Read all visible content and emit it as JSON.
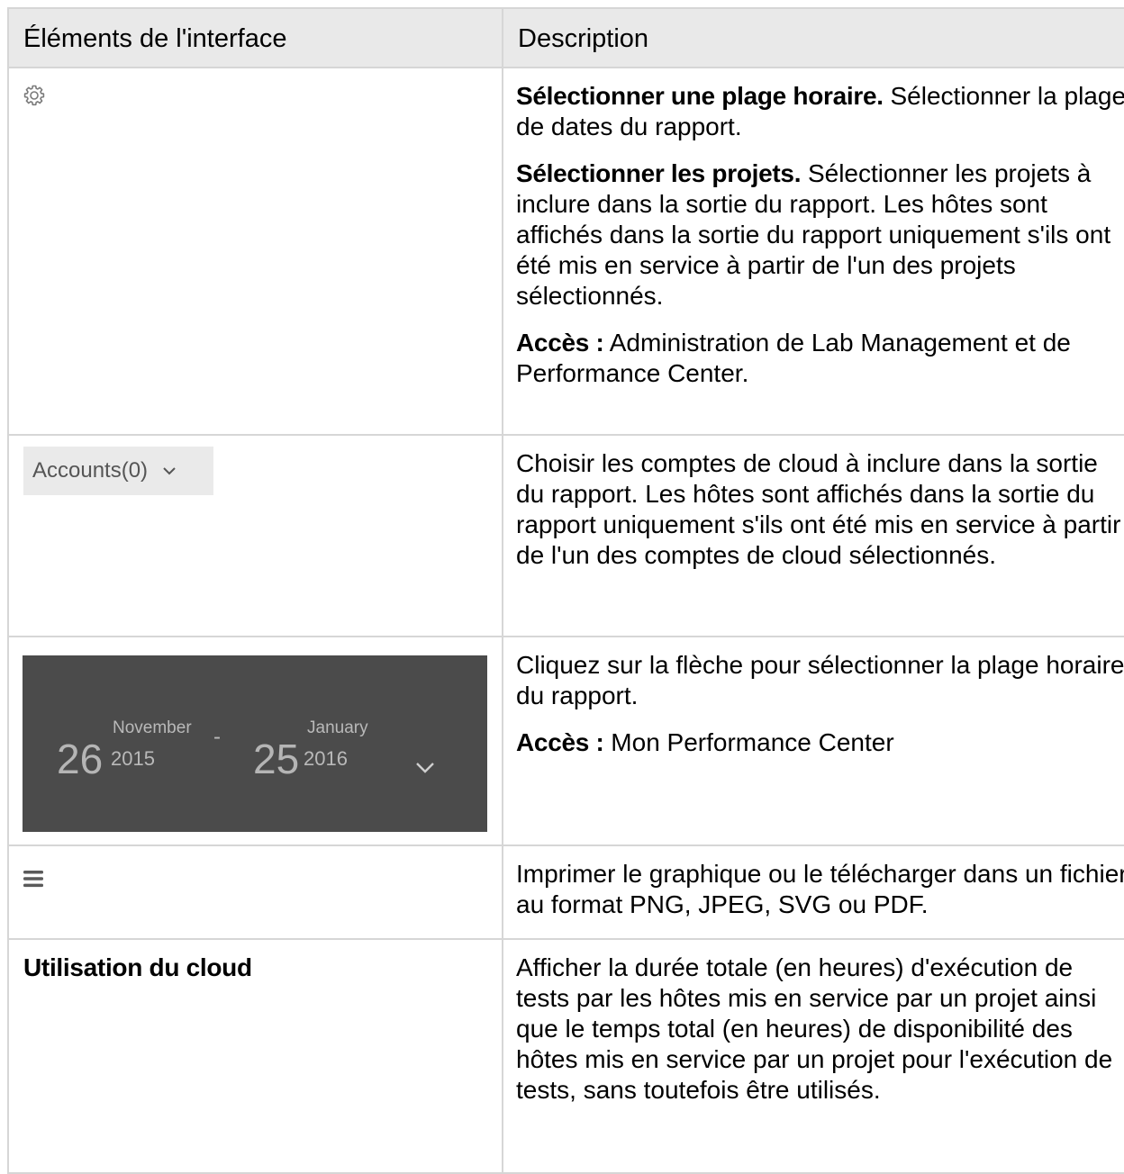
{
  "table": {
    "headers": {
      "elements": "Éléments de l'interface",
      "description": "Description"
    },
    "rows": [
      {
        "element_icon": "gear-icon",
        "desc": [
          {
            "bold": "Sélectionner une plage horaire.",
            "text": " Sélectionner la plage de dates du rapport."
          },
          {
            "bold": "Sélectionner les projets.",
            "text": " Sélectionner les projets à inclure dans la sortie du rapport. Les hôtes sont affichés dans la sortie du rapport uniquement s'ils ont été mis en service à partir de l'un des projets sélectionnés."
          },
          {
            "bold": "Accès :",
            "text": " Administration de Lab Management et de Performance Center."
          }
        ]
      },
      {
        "element_dropdown": {
          "label": "Accounts(0)",
          "icon": "chevron-down-icon"
        },
        "desc": [
          {
            "text": "Choisir les comptes de cloud à inclure dans la sortie du rapport. Les hôtes sont affichés dans la sortie du rapport uniquement s'ils ont été mis en service à partir de l'un des comptes de cloud sélectionnés."
          }
        ]
      },
      {
        "element_daterange": {
          "start_day": "26",
          "start_month": "November",
          "start_year": "2015",
          "separator": "-",
          "end_day": "25",
          "end_month": "January",
          "end_year": "2016",
          "icon": "chevron-down-icon"
        },
        "desc": [
          {
            "text": "Cliquez sur la flèche pour sélectionner la plage horaire du rapport."
          },
          {
            "bold": "Accès :",
            "text": " Mon Performance Center"
          }
        ]
      },
      {
        "element_icon": "menu-icon",
        "desc": [
          {
            "text": "Imprimer le graphique ou le télécharger dans un fichier au format PNG, JPEG, SVG ou PDF."
          }
        ]
      },
      {
        "element_label": "Utilisation du cloud",
        "desc": [
          {
            "text": "Afficher la durée totale (en heures) d'exécution de tests par les hôtes mis en service par un projet ainsi que le temps total (en heures) de disponibilité des hôtes mis en service par un projet pour l'exécution de tests, sans toutefois être utilisés."
          }
        ]
      }
    ]
  },
  "colors": {
    "header_bg": "#e9e9e9",
    "border": "#d6d6d6",
    "picker_bg": "#4b4b4b",
    "dropdown_bg": "#eaeaea"
  }
}
